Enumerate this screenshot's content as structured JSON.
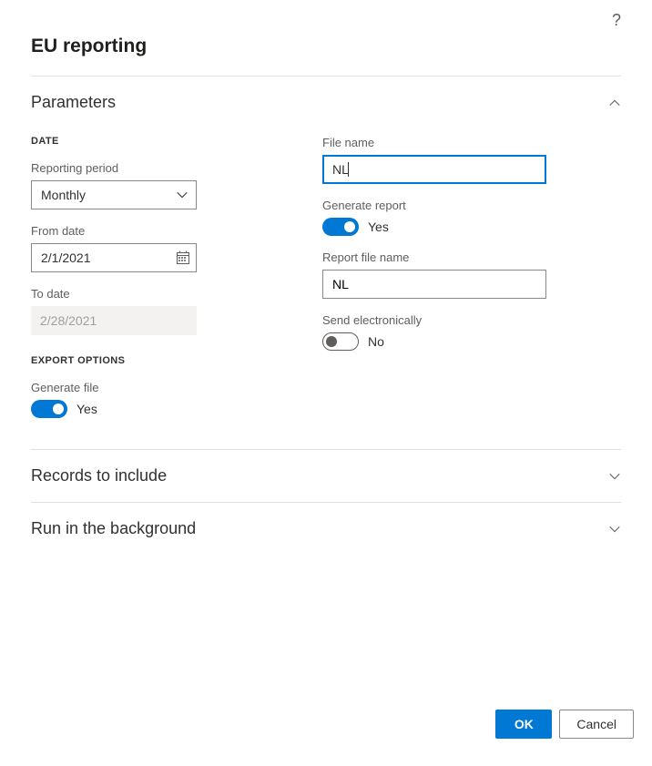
{
  "header": {
    "title": "EU reporting"
  },
  "sections": {
    "parameters": {
      "title": "Parameters",
      "expanded": true
    },
    "records": {
      "title": "Records to include",
      "expanded": false
    },
    "background": {
      "title": "Run in the background",
      "expanded": false
    }
  },
  "groups": {
    "date": "DATE",
    "export_options": "EXPORT OPTIONS"
  },
  "labels": {
    "reporting_period": "Reporting period",
    "from_date": "From date",
    "to_date": "To date",
    "generate_file": "Generate file",
    "file_name": "File name",
    "generate_report": "Generate report",
    "report_file_name": "Report file name",
    "send_electronically": "Send electronically"
  },
  "values": {
    "reporting_period": "Monthly",
    "from_date": "2/1/2021",
    "to_date": "2/28/2021",
    "generate_file": true,
    "generate_file_text": "Yes",
    "file_name": "NL",
    "generate_report": true,
    "generate_report_text": "Yes",
    "report_file_name": "NL",
    "send_electronically": false,
    "send_electronically_text": "No"
  },
  "buttons": {
    "ok": "OK",
    "cancel": "Cancel"
  }
}
